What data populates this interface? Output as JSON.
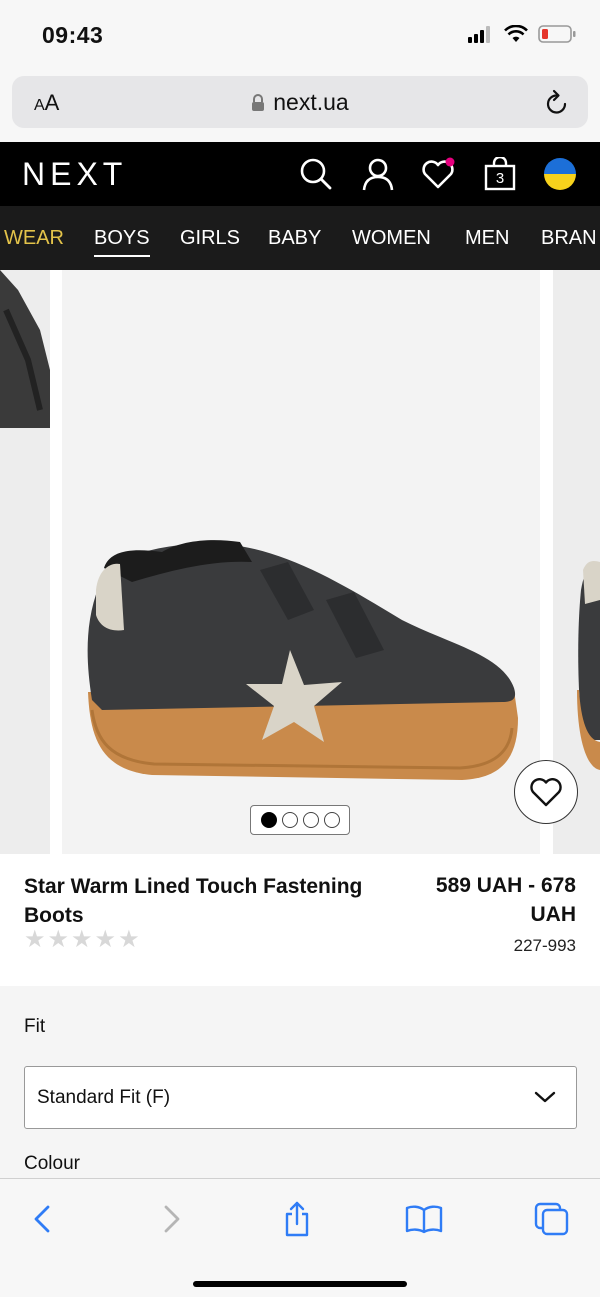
{
  "status_bar": {
    "time": "09:43"
  },
  "browser": {
    "text_size_label_small": "A",
    "text_size_label_large": "A",
    "url": "next.ua"
  },
  "header": {
    "logo": "NEXT",
    "bag_count": "3",
    "wishlist_dot_color": "#e6007e"
  },
  "categories": [
    "WEAR",
    "BOYS",
    "GIRLS",
    "BABY",
    "WOMEN",
    "MEN",
    "BRAN"
  ],
  "active_category": "BOYS",
  "carousel": {
    "slide_count": 4,
    "active_slide": 1
  },
  "product": {
    "title": "Star Warm Lined Touch Fastening Boots",
    "price": "589 UAH - 678 UAH",
    "sku": "227-993",
    "rating_stars": 5,
    "rating_filled": 0
  },
  "options": {
    "fit_label": "Fit",
    "fit_value": "Standard Fit (F)",
    "colour_label": "Colour"
  },
  "toolbar": {
    "icons": [
      "back-icon",
      "forward-icon",
      "share-icon",
      "bookmarks-icon",
      "tabs-icon"
    ],
    "accent": "#2f7cf6"
  }
}
